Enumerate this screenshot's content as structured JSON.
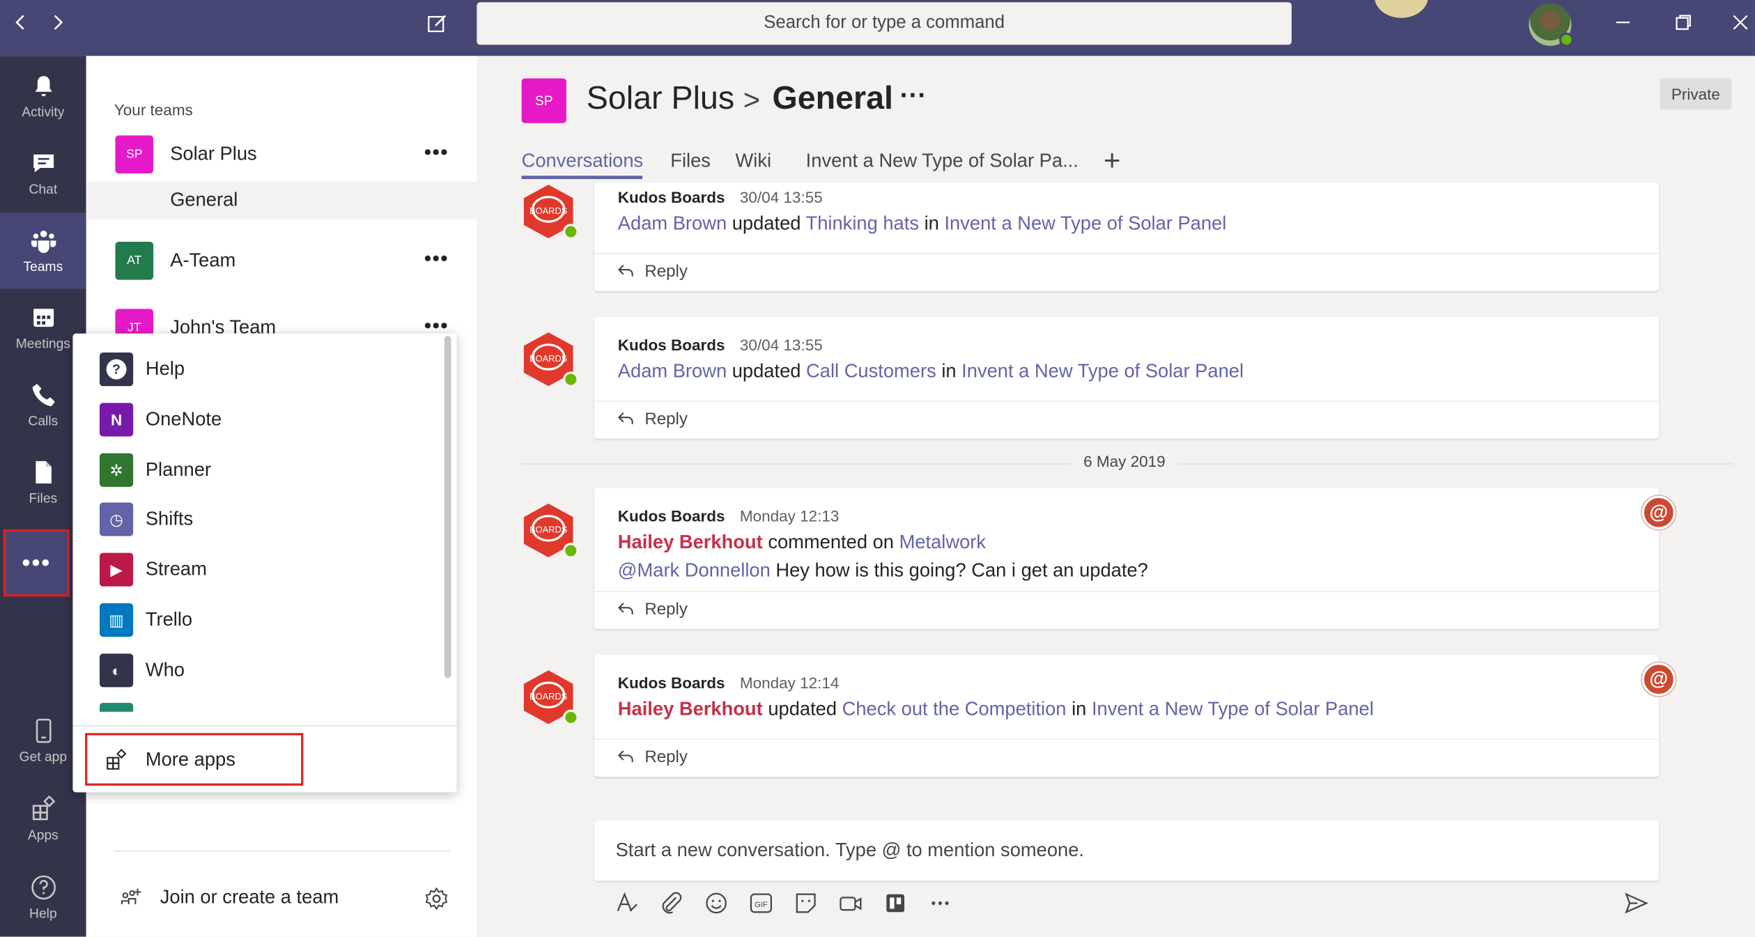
{
  "search": {
    "placeholder": "Search for or type a command"
  },
  "appbar": {
    "items": [
      {
        "label": "Activity",
        "icon": "bell-icon"
      },
      {
        "label": "Chat",
        "icon": "chat-icon"
      },
      {
        "label": "Teams",
        "icon": "teams-icon"
      },
      {
        "label": "Meetings",
        "icon": "calendar-icon"
      },
      {
        "label": "Calls",
        "icon": "phone-icon"
      },
      {
        "label": "Files",
        "icon": "file-icon"
      }
    ],
    "more": "•••",
    "bottom": [
      {
        "label": "Get app",
        "icon": "phone-device-icon"
      },
      {
        "label": "Apps",
        "icon": "apps-icon"
      },
      {
        "label": "Help",
        "icon": "help-icon"
      }
    ]
  },
  "teams_pane": {
    "section_label": "Your teams",
    "teams": [
      {
        "initials": "SP",
        "name": "Solar Plus",
        "color": "#e619c8"
      },
      {
        "initials": "AT",
        "name": "A-Team",
        "color": "#237b4b"
      },
      {
        "initials": "JT",
        "name": "John's Team",
        "color": "#e619c8"
      }
    ],
    "active_channel": "General",
    "more_label": "•••",
    "join_label": "Join or create a team"
  },
  "popup": {
    "items": [
      {
        "label": "Help",
        "icon_text": "?",
        "color": "#33344a"
      },
      {
        "label": "OneNote",
        "icon_text": "N",
        "color": "#7719aa"
      },
      {
        "label": "Planner",
        "icon_text": "✲",
        "color": "#31752f"
      },
      {
        "label": "Shifts",
        "icon_text": "◷",
        "color": "#6264a7"
      },
      {
        "label": "Stream",
        "icon_text": "▶",
        "color": "#bc1948"
      },
      {
        "label": "Trello",
        "icon_text": "▥",
        "color": "#0079bf"
      },
      {
        "label": "Who",
        "icon_text": "◐",
        "color": "#33344a"
      }
    ],
    "more_apps_label": "More apps"
  },
  "header": {
    "team_initials": "SP",
    "team": "Solar Plus",
    "separator": ">",
    "channel": "General",
    "more": "···",
    "privacy": "Private",
    "tabs": [
      "Conversations",
      "Files",
      "Wiki",
      "Invent a New Type of Solar Pa..."
    ],
    "add_tab": "+"
  },
  "messages": [
    {
      "sender": "Kudos Boards",
      "time": "30/04 13:55",
      "line1": {
        "user": "Adam Brown",
        "verb": " updated ",
        "item": "Thinking hats",
        "prep": " in ",
        "board": "Invent a New Type of Solar Panel"
      },
      "reply": "Reply",
      "bot_label": "BOARDS"
    },
    {
      "sender": "Kudos Boards",
      "time": "30/04 13:55",
      "line1": {
        "user": "Adam Brown",
        "verb": " updated ",
        "item": "Call Customers",
        "prep": " in ",
        "board": "Invent a New Type of Solar Panel"
      },
      "reply": "Reply",
      "bot_label": "BOARDS"
    },
    {
      "sender": "Kudos Boards",
      "time": "Monday 12:13",
      "line1": {
        "user": "Hailey Berkhout",
        "verb": " commented on ",
        "item": "Metalwork"
      },
      "line2": {
        "mention": "@Mark Donnellon",
        "text": " Hey how is this going? Can i get an update?"
      },
      "reply": "Reply",
      "bot_label": "BOARDS",
      "badge": "@"
    },
    {
      "sender": "Kudos Boards",
      "time": "Monday 12:14",
      "line1": {
        "user": "Hailey Berkhout",
        "verb": " updated ",
        "item": "Check out the Competition",
        "prep": " in ",
        "board": "Invent a New Type of Solar Panel"
      },
      "reply": "Reply",
      "bot_label": "BOARDS",
      "badge": "@"
    }
  ],
  "date_divider": "6 May 2019",
  "compose": {
    "placeholder": "Start a new conversation. Type @ to mention someone.",
    "tools": [
      "format-icon",
      "attach-icon",
      "emoji-icon",
      "gif-icon",
      "sticker-icon",
      "meet-icon",
      "trello-icon",
      "more-icon",
      "send-icon"
    ]
  }
}
